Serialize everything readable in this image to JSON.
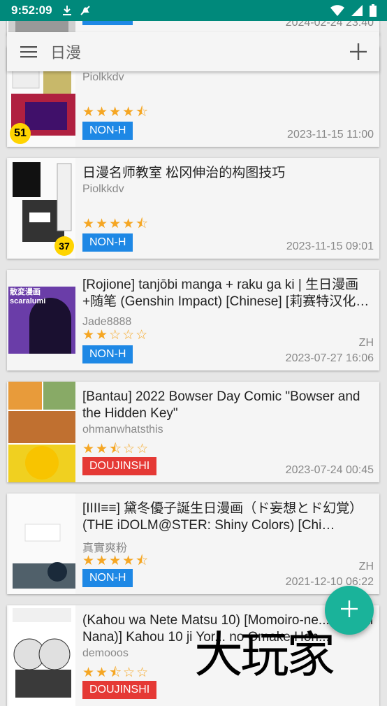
{
  "status_bar": {
    "time": "9:52:09",
    "icons_left": [
      "download-icon",
      "no-notification-icon"
    ],
    "icons_right": [
      "wifi-icon",
      "signal-icon",
      "battery-icon"
    ]
  },
  "search": {
    "query": "日漫",
    "menu_icon": "hamburger-icon",
    "add_icon": "plus-icon"
  },
  "colors": {
    "status_bar": "#00897b",
    "non_h_badge": "#1e88e5",
    "doujinshi_badge": "#e53935",
    "star": "#f5a623",
    "fab": "#1ab39a"
  },
  "gallery_list": [
    {
      "title": "",
      "uploader": "",
      "rating": "",
      "category": "NON-H",
      "language": "",
      "date": "2024-02-24 23:40"
    },
    {
      "title": "",
      "uploader": "Piolkkdv",
      "rating": "★★★★⯪",
      "category": "NON-H",
      "language": "",
      "date": "2023-11-15 11:00",
      "thumb_text": "51"
    },
    {
      "title": "日漫名师教室 松冈伸治的构图技巧",
      "uploader": "Piolkkdv",
      "rating": "★★★★⯪",
      "category": "NON-H",
      "language": "",
      "date": "2023-11-15 09:01",
      "thumb_text": "37"
    },
    {
      "title": "[Rojione] tanjōbi manga + raku ga ki | 生日漫画+随笔 (Genshin Impact) [Chinese] [莉赛特汉化…",
      "uploader": "Jade8888",
      "rating": "★★☆☆☆",
      "category": "NON-H",
      "language": "ZH",
      "date": "2023-07-27 16:06",
      "thumb_text": "散変漫画 scaralumi"
    },
    {
      "title": "[Bantau] 2022 Bowser Day Comic \"Bowser and the Hidden Key\"",
      "uploader": "ohmanwhatsthis",
      "rating": "★★⯪☆☆",
      "category": "DOUJINSHI",
      "language": "",
      "date": "2023-07-24 00:45"
    },
    {
      "title": "[IIII≡≡] 黛冬優子誕生日漫画（ド妄想とド幻覚）(THE iDOLM@STER: Shiny Colors) [Chi…",
      "uploader": "真實爽粉",
      "rating": "★★★★⯪",
      "category": "NON-H",
      "language": "ZH",
      "date": "2021-12-10 06:22"
    },
    {
      "title": "(Kahou wa Nete Matsu 10) [Momoiro-ne... (Kisaki Nana)] Kahou 10 ji Yor... no Omake Hon...",
      "uploader": "demooos",
      "rating": "★★⯪☆☆",
      "category": "DOUJINSHI",
      "language": "",
      "date": ""
    }
  ],
  "fab": {
    "icon": "plus-icon"
  },
  "watermark": "大玩家"
}
